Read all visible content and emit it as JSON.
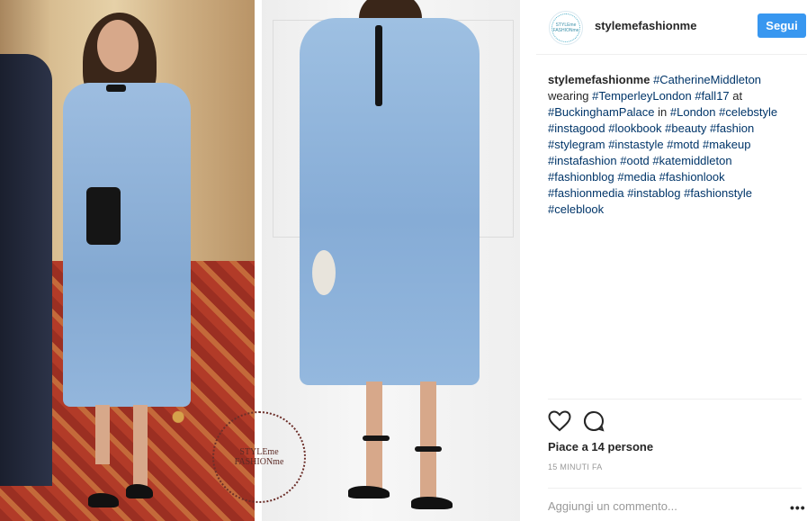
{
  "post": {
    "username": "stylemefashionme",
    "avatar_text": "STYLEme FASHIONme",
    "follow_label": "Segui",
    "watermark_line1": "STYLEme",
    "watermark_line2": "FASHIONme",
    "caption": {
      "username": "stylemefashionme",
      "parts": [
        {
          "text": "#CatherineMiddleton",
          "tag": true
        },
        {
          "text": " wearing ",
          "tag": false
        },
        {
          "text": "#TemperleyLondon",
          "tag": true
        },
        {
          "text": " ",
          "tag": false
        },
        {
          "text": "#fall17",
          "tag": true
        },
        {
          "text": " at ",
          "tag": false
        },
        {
          "text": "#BuckinghamPalace",
          "tag": true
        },
        {
          "text": " in ",
          "tag": false
        },
        {
          "text": "#London",
          "tag": true
        },
        {
          "text": " ",
          "tag": false
        },
        {
          "text": "#celebstyle",
          "tag": true
        },
        {
          "text": " ",
          "tag": false
        },
        {
          "text": "#instagood",
          "tag": true
        },
        {
          "text": " ",
          "tag": false
        },
        {
          "text": "#lookbook",
          "tag": true
        },
        {
          "text": " ",
          "tag": false
        },
        {
          "text": "#beauty",
          "tag": true
        },
        {
          "text": " ",
          "tag": false
        },
        {
          "text": "#fashion",
          "tag": true
        },
        {
          "text": " ",
          "tag": false
        },
        {
          "text": "#stylegram",
          "tag": true
        },
        {
          "text": " ",
          "tag": false
        },
        {
          "text": "#instastyle",
          "tag": true
        },
        {
          "text": " ",
          "tag": false
        },
        {
          "text": "#motd",
          "tag": true
        },
        {
          "text": " ",
          "tag": false
        },
        {
          "text": "#makeup",
          "tag": true
        },
        {
          "text": " ",
          "tag": false
        },
        {
          "text": "#instafashion",
          "tag": true
        },
        {
          "text": " ",
          "tag": false
        },
        {
          "text": "#ootd",
          "tag": true
        },
        {
          "text": " ",
          "tag": false
        },
        {
          "text": "#katemiddleton",
          "tag": true
        },
        {
          "text": " ",
          "tag": false
        },
        {
          "text": "#fashionblog",
          "tag": true
        },
        {
          "text": " ",
          "tag": false
        },
        {
          "text": "#media",
          "tag": true
        },
        {
          "text": " ",
          "tag": false
        },
        {
          "text": "#fashionlook",
          "tag": true
        },
        {
          "text": " ",
          "tag": false
        },
        {
          "text": "#fashionmedia",
          "tag": true
        },
        {
          "text": " ",
          "tag": false
        },
        {
          "text": "#instablog",
          "tag": true
        },
        {
          "text": " ",
          "tag": false
        },
        {
          "text": "#fashionstyle",
          "tag": true
        },
        {
          "text": " ",
          "tag": false
        },
        {
          "text": "#celeblook",
          "tag": true
        }
      ]
    },
    "likes": "Piace a 14 persone",
    "time": "15 MINUTI FA",
    "comment_placeholder": "Aggiungi un commento...",
    "more_label": "•••",
    "icons": {
      "like": "heart-icon",
      "comment": "comment-bubble-icon",
      "more": "more-options-icon"
    }
  },
  "colors": {
    "accent": "#3897f0",
    "hashtag": "#003569",
    "dress": "#8fb3d9"
  }
}
